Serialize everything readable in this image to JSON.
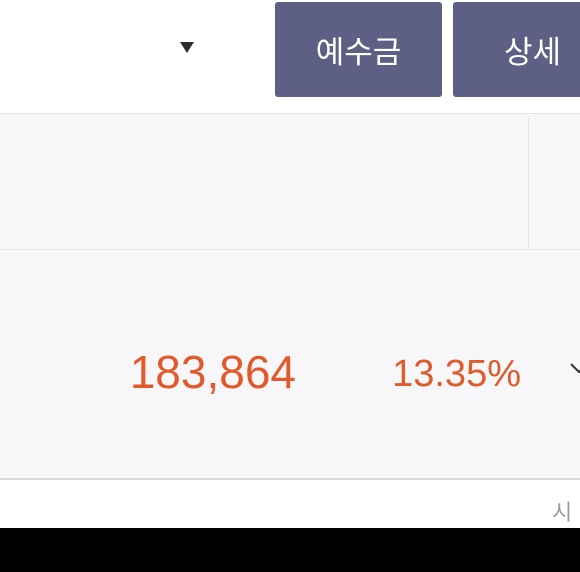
{
  "toolbar": {
    "dropdown_icon": "caret-down-icon",
    "deposit_button": "예수금",
    "detail_button": "상세"
  },
  "holding": {
    "amount": "183,864",
    "rate": "13.35%",
    "expand_icon": "chevron-down-icon"
  },
  "footer": {
    "partial_text": "시"
  },
  "colors": {
    "button_bg": "#5d5f84",
    "positive": "#e05a2b",
    "row_bg": "#f7f7f9"
  }
}
